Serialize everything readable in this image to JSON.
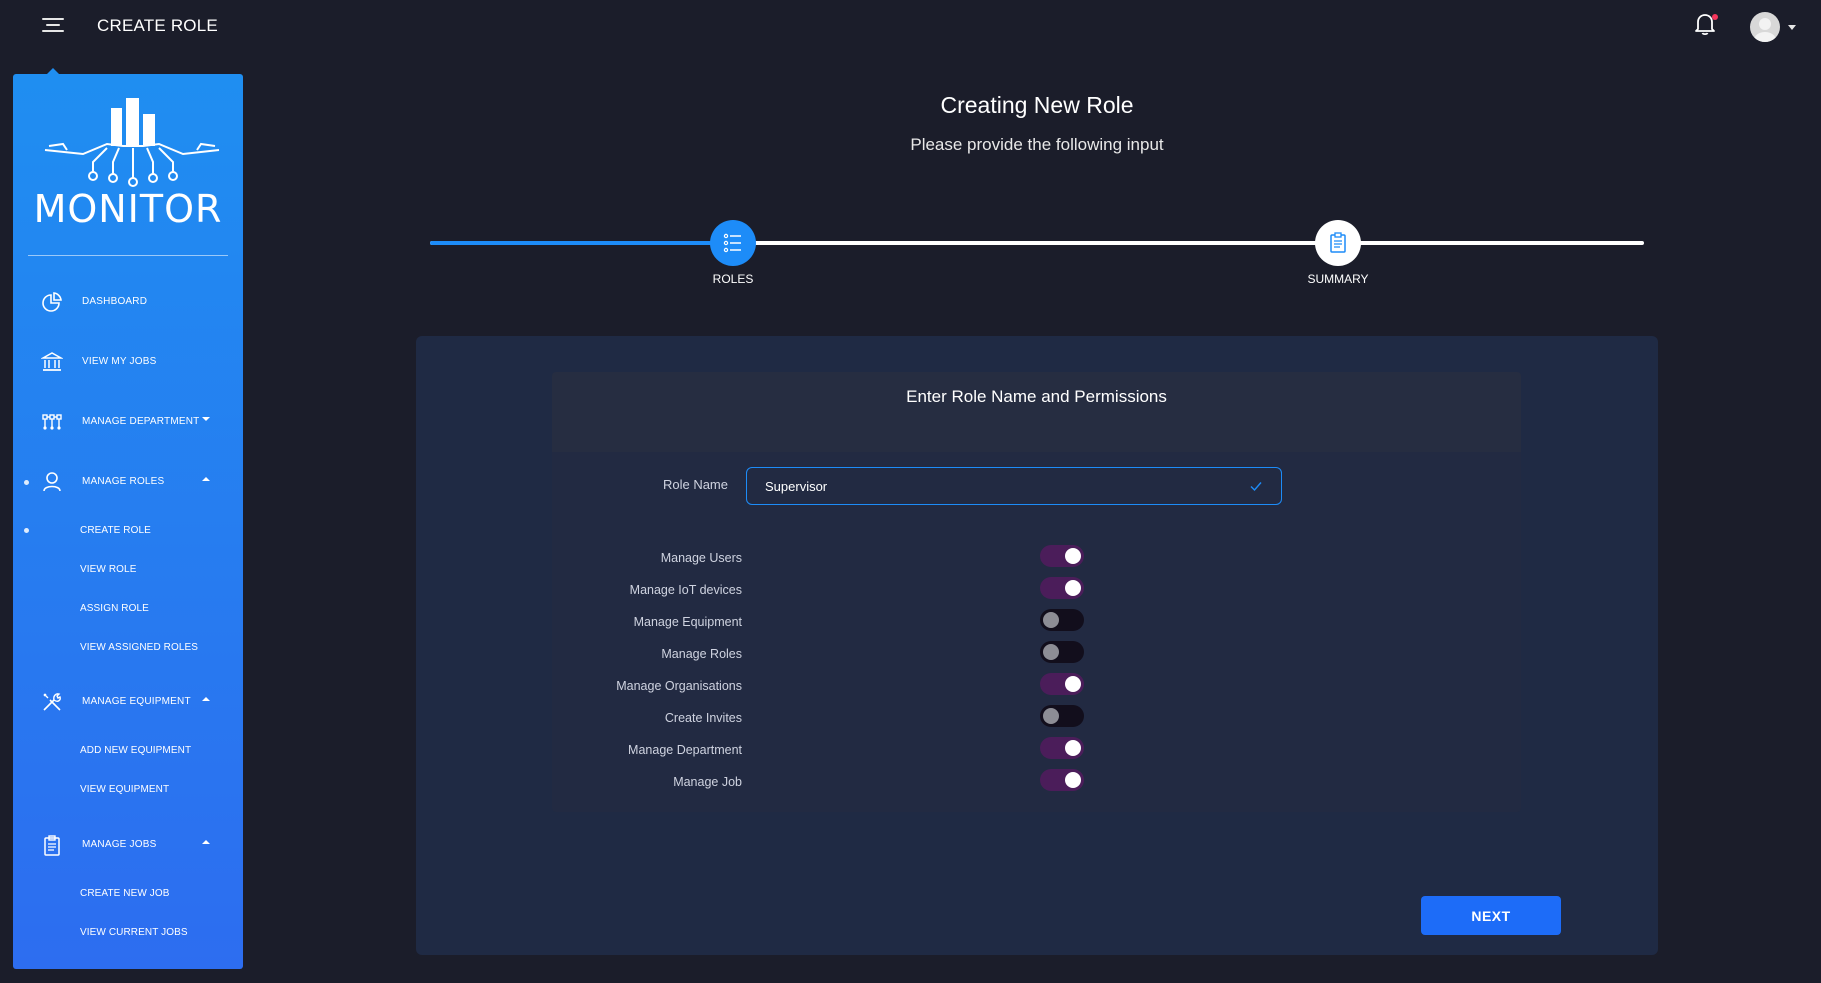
{
  "topbar": {
    "title": "CREATE ROLE",
    "menu_icon": "hamburger-icon",
    "bell_icon": "bell-icon",
    "avatar_icon": "avatar-icon"
  },
  "sidebar": {
    "brand": "MONITOR",
    "items": [
      {
        "label": "DASHBOARD",
        "icon": "pie-chart-icon"
      },
      {
        "label": "VIEW MY JOBS",
        "icon": "bank-icon"
      },
      {
        "label": "MANAGE DEPARTMENT",
        "icon": "org-chart-icon"
      },
      {
        "label": "MANAGE ROLES",
        "icon": "user-icon"
      },
      {
        "label": "MANAGE EQUIPMENT",
        "icon": "tools-icon"
      },
      {
        "label": "MANAGE JOBS",
        "icon": "clipboard-icon"
      }
    ],
    "roles_sub": [
      "CREATE ROLE",
      "VIEW ROLE",
      "ASSIGN ROLE",
      "VIEW ASSIGNED ROLES"
    ],
    "equipment_sub": [
      "ADD NEW EQUIPMENT",
      "VIEW EQUIPMENT"
    ],
    "jobs_sub": [
      "CREATE NEW JOB",
      "VIEW CURRENT JOBS"
    ]
  },
  "main": {
    "heading": "Creating New Role",
    "subheading": "Please provide the following input",
    "steps": [
      {
        "label": "ROLES",
        "icon": "list-icon"
      },
      {
        "label": "SUMMARY",
        "icon": "clipboard-icon"
      }
    ],
    "progress_fraction": 0.25,
    "card_title": "Enter Role Name and Permissions",
    "role_name_label": "Role Name",
    "role_name_value": "Supervisor",
    "permissions": [
      {
        "label": "Manage Users",
        "enabled": true
      },
      {
        "label": "Manage IoT devices",
        "enabled": true
      },
      {
        "label": "Manage Equipment",
        "enabled": false
      },
      {
        "label": "Manage Roles",
        "enabled": false
      },
      {
        "label": "Manage Organisations",
        "enabled": true
      },
      {
        "label": "Create Invites",
        "enabled": false
      },
      {
        "label": "Manage Department",
        "enabled": true
      },
      {
        "label": "Manage Job",
        "enabled": true
      }
    ],
    "next_label": "NEXT"
  },
  "colors": {
    "background": "#1b1d2a",
    "sidebar_top": "#1f8ef1",
    "sidebar_bottom": "#2d6df0",
    "accent": "#1d8cf8",
    "toggle_on": "#4b1d5a",
    "card": "#1f2a44"
  }
}
